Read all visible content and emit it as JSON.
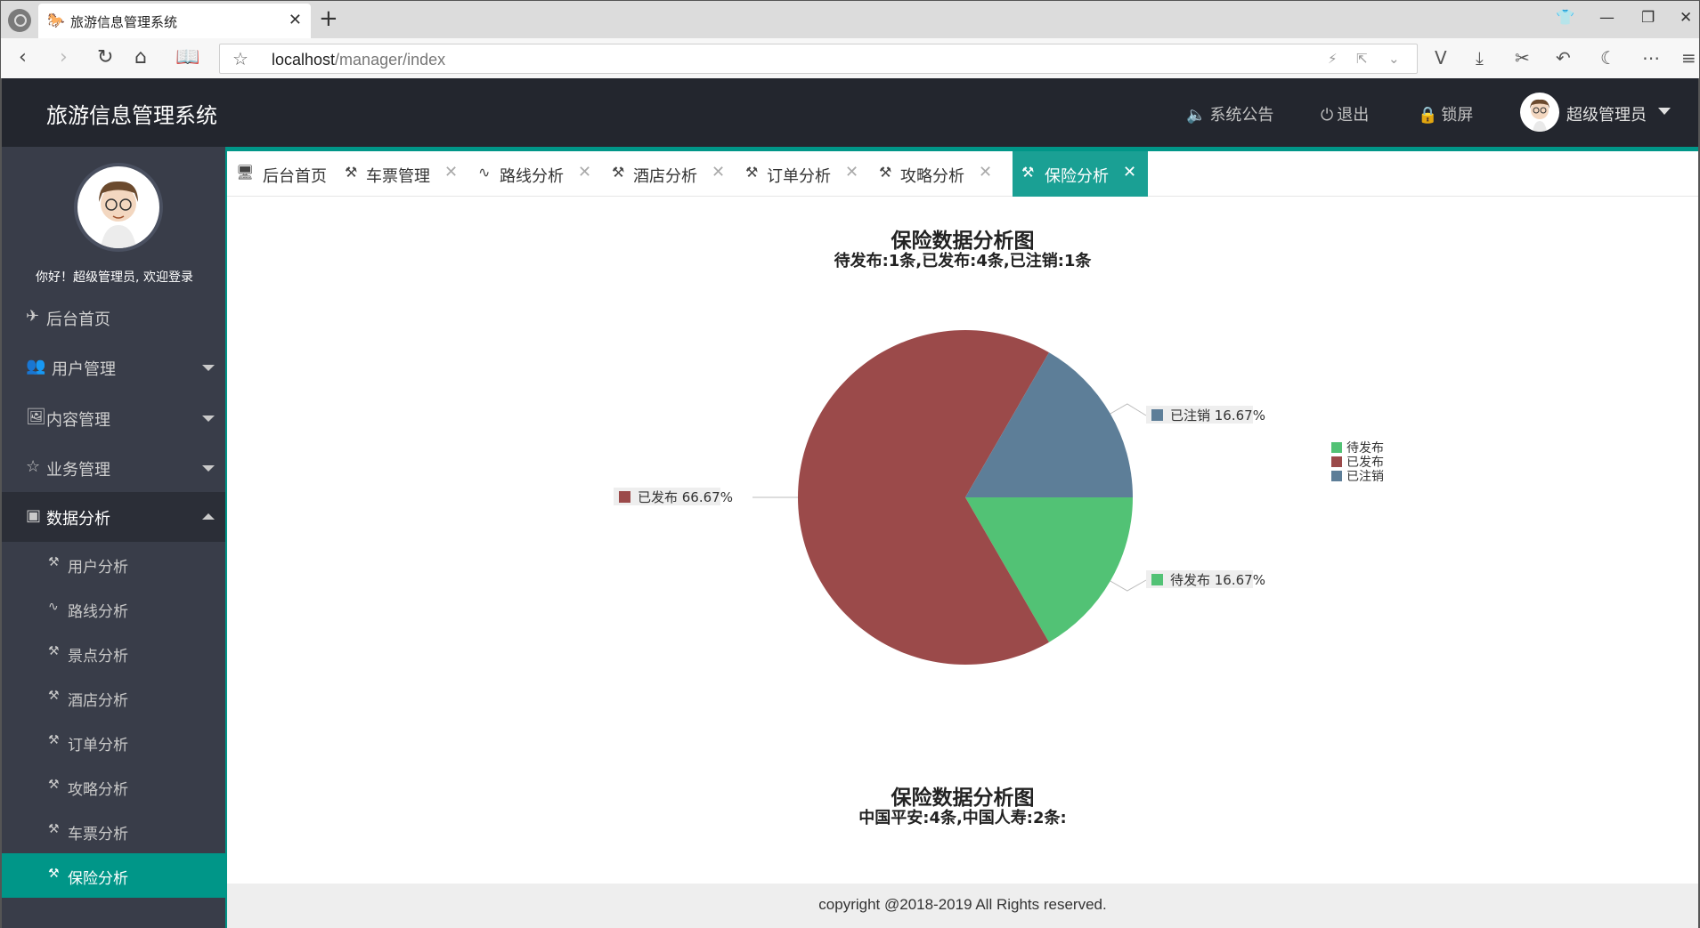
{
  "browser": {
    "tab_title": "旅游信息管理系统",
    "url_host": "localhost",
    "url_path": "/manager/index"
  },
  "header": {
    "app_title": "旅游信息管理系统",
    "notice": "系统公告",
    "logout": "退出",
    "lock": "锁屏",
    "user": "超级管理员"
  },
  "sidebar": {
    "welcome": "你好！超级管理员, 欢迎登录",
    "items": [
      {
        "label": "后台首页"
      },
      {
        "label": "用户管理"
      },
      {
        "label": "内容管理"
      },
      {
        "label": "业务管理"
      },
      {
        "label": "数据分析"
      }
    ],
    "sub_items": [
      {
        "label": "用户分析"
      },
      {
        "label": "路线分析"
      },
      {
        "label": "景点分析"
      },
      {
        "label": "酒店分析"
      },
      {
        "label": "订单分析"
      },
      {
        "label": "攻略分析"
      },
      {
        "label": "车票分析"
      },
      {
        "label": "保险分析"
      }
    ]
  },
  "page_tabs": [
    {
      "label": "后台首页"
    },
    {
      "label": "车票管理"
    },
    {
      "label": "路线分析"
    },
    {
      "label": "酒店分析"
    },
    {
      "label": "订单分析"
    },
    {
      "label": "攻略分析"
    },
    {
      "label": "保险分析"
    }
  ],
  "chart_data": [
    {
      "type": "pie",
      "title": "保险数据分析图",
      "subtitle": "待发布:1条,已发布:4条,已注销:1条",
      "categories": [
        "待发布",
        "已发布",
        "已注销"
      ],
      "values": [
        1,
        4,
        1
      ],
      "labels": [
        "待发布 16.67%",
        "已发布 66.67%",
        "已注销 16.67%"
      ],
      "colors": [
        "#52c275",
        "#9b4a4a",
        "#5d7e98"
      ],
      "legend": "right"
    },
    {
      "type": "pie",
      "title": "保险数据分析图",
      "subtitle": "中国平安:4条,中国人寿:2条:"
    }
  ],
  "footer": {
    "text": "copyright @2018-2019 All Rights reserved."
  }
}
